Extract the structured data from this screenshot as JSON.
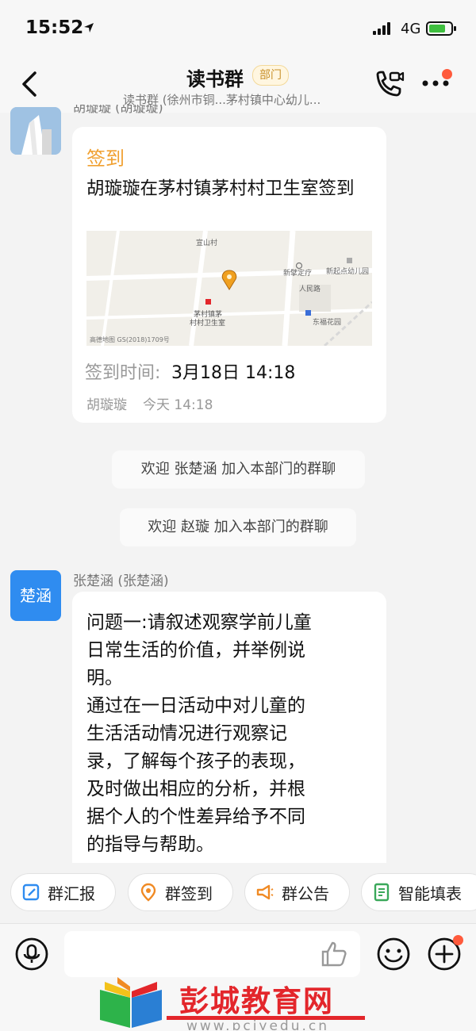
{
  "status_bar": {
    "time": "15:52",
    "network": "4G"
  },
  "header": {
    "back": "‹",
    "title": "读书群",
    "badge": "部门",
    "subtitle": "读书群 (徐州市铜...茅村镇中心幼儿..."
  },
  "messages": {
    "checkin": {
      "sender": "胡璇璇 (胡璇璇)",
      "title": "签到",
      "text": "胡璇璇在茅村镇茅村村卫生室签到",
      "map": {
        "label_north": "宣山村",
        "label_office": "新擘定疗",
        "label_road": "人民路",
        "label_kindergarten": "新起点幼儿园",
        "label_clinic_1": "茅村镇茅",
        "label_clinic_2": "村村卫生室",
        "label_garden": "东福花园",
        "watermark": "高德地图 GS(2018)1709号"
      },
      "time_label": "签到时间:",
      "time_value": "3月18日 14:18",
      "footer_name": "胡璇璇",
      "footer_time": "今天 14:18"
    },
    "system": [
      "欢迎 张楚涵 加入本部门的群聊",
      "欢迎 赵璇 加入本部门的群聊"
    ],
    "text_msg": {
      "avatar_text": "楚涵",
      "sender": "张楚涵 (张楚涵)",
      "lines": [
        "问题一:请叙述观察学前儿童",
        "日常生活的价值，并举例说",
        "明。",
        "通过在一日活动中对儿童的",
        "生活活动情况进行观察记",
        "录，了解每个孩子的表现，",
        "及时做出相应的分析，并根",
        "据个人的个性差异给予不同",
        "的指导与帮助。"
      ]
    }
  },
  "toolbar": [
    {
      "label": "群汇报",
      "icon": "report-icon"
    },
    {
      "label": "群签到",
      "icon": "location-pin-icon"
    },
    {
      "label": "群公告",
      "icon": "megaphone-icon"
    },
    {
      "label": "智能填表",
      "icon": "form-icon"
    }
  ],
  "watermark_brand": {
    "text": "彭城教育网",
    "url": "www.pcjyedu.cn"
  },
  "colors": {
    "accent_orange": "#f08a24",
    "checkin_title": "#f0a030",
    "avatar_blue": "#2f8cf0",
    "brand_red": "#e3262b",
    "notification_dot": "#ff5a3c"
  }
}
